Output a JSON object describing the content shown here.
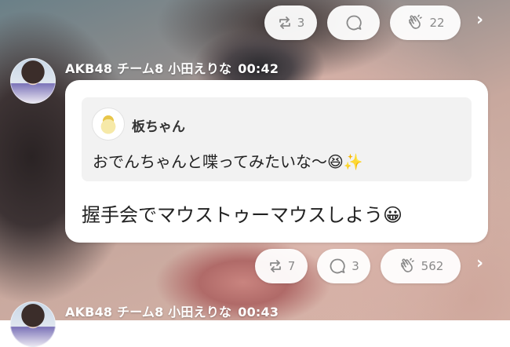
{
  "post_top": {
    "retweet": {
      "icon": "retweet-icon",
      "count": "3"
    },
    "comment": {
      "icon": "comment-icon",
      "count": ""
    },
    "clap": {
      "icon": "clap-icon",
      "count": "22"
    },
    "more": "›"
  },
  "post": {
    "author": "AKB48 チーム8 小田えりな",
    "time": "00:42",
    "quote": {
      "name": "板ちゃん",
      "text": "おでんちゃんと喋ってみたいな〜😆✨"
    },
    "message": "握手会でマウストゥーマウスしよう😀",
    "actions": {
      "retweet_count": "7",
      "comment_count": "3",
      "clap_count": "562",
      "more": "›"
    }
  },
  "next_post": {
    "author": "AKB48 チーム8 小田えりな",
    "time": "00:43"
  },
  "colors": {
    "bubble": "#ffffff",
    "quote_bg": "#f2f2f2",
    "icon_gray": "#8a8a8a",
    "header_text": "#ffffff"
  }
}
